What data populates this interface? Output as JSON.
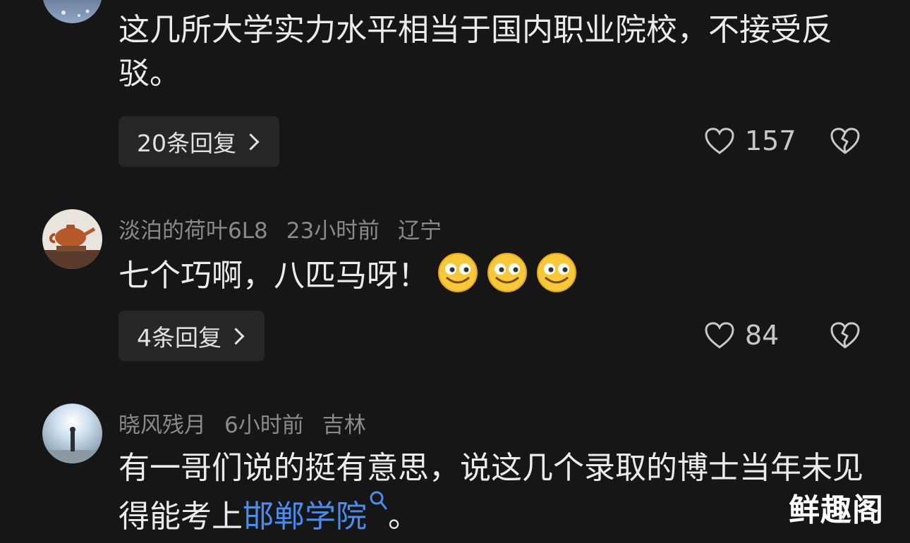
{
  "comments": [
    {
      "text": "这几所大学实力水平相当于国内职业院校，不接受反驳。",
      "replies_label": "20条回复",
      "likes": "157"
    },
    {
      "username": "淡泊的荷叶6L8",
      "time": "23小时前",
      "location": "辽宁",
      "text": "七个巧啊，八匹马呀！",
      "emoji": "smile-emoji",
      "replies_label": "4条回复",
      "likes": "84"
    },
    {
      "username": "晓风残月",
      "time": "6小时前",
      "location": "吉林",
      "text_before": "有一哥们说的挺有意思，说这几个录取的博士当年未见得能考上",
      "link_text": "邯郸学院",
      "text_after": "。"
    }
  ],
  "watermark": "鲜趣阁",
  "colors": {
    "background": "#161616",
    "link": "#4a8df0",
    "meta": "#8a8a8a",
    "reply_button_bg": "#262626"
  }
}
